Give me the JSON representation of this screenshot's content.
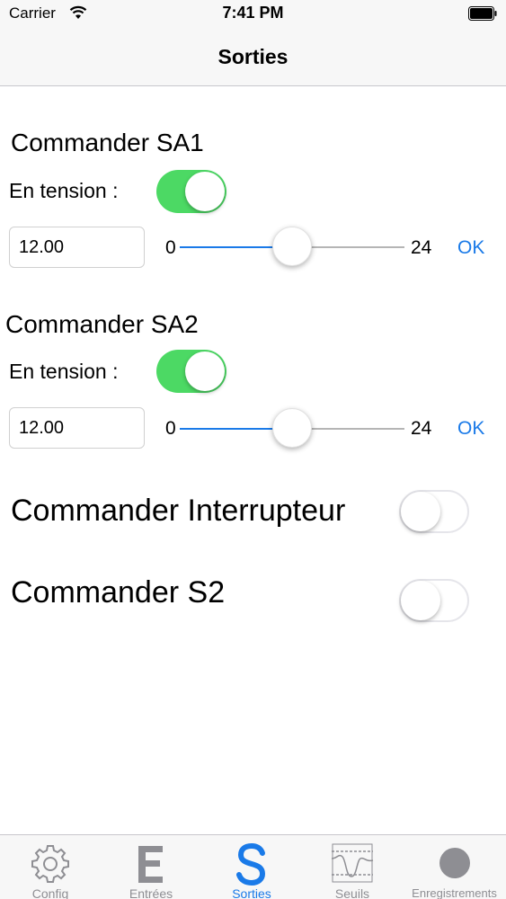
{
  "status_bar": {
    "carrier": "Carrier",
    "time": "7:41 PM"
  },
  "nav": {
    "title": "Sorties"
  },
  "sa1": {
    "title": "Commander SA1",
    "power_label": "En tension :",
    "power_on": true,
    "value": "12.00",
    "slider_min": "0",
    "slider_max": "24",
    "slider_value": 12,
    "ok_label": "OK"
  },
  "sa2": {
    "title": "Commander SA2",
    "power_label": "En tension :",
    "power_on": true,
    "value": "12.00",
    "slider_min": "0",
    "slider_max": "24",
    "slider_value": 12,
    "ok_label": "OK"
  },
  "interrupteur": {
    "title": "Commander Interrupteur",
    "on": false
  },
  "s2": {
    "title": "Commander S2",
    "on": false
  },
  "colors": {
    "accent": "#1a7ae8",
    "switch_on": "#4cd964",
    "inactive": "#8e8e93"
  },
  "tabs": [
    {
      "label": "Config",
      "icon": "gear-icon",
      "active": false
    },
    {
      "label": "Entrées",
      "icon": "letter-e-icon",
      "active": false
    },
    {
      "label": "Sorties",
      "icon": "letter-s-icon",
      "active": true
    },
    {
      "label": "Seuils",
      "icon": "threshold-wave-icon",
      "active": false
    },
    {
      "label": "Enregistrements",
      "icon": "circle-icon",
      "active": false
    }
  ]
}
